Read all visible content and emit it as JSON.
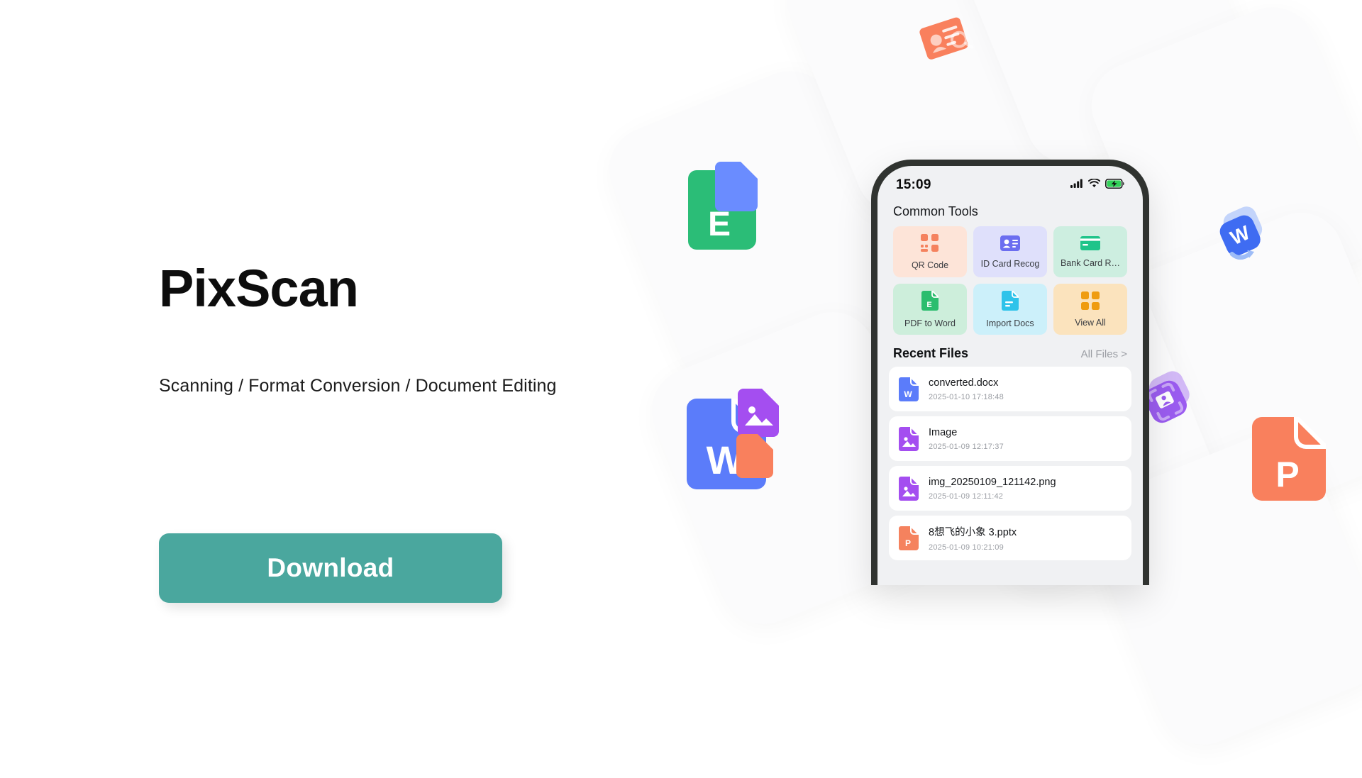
{
  "hero": {
    "title": "PixScan",
    "subtitle": "Scanning / Format Conversion / Document Editing",
    "download_label": "Download",
    "accent_color": "#4aa79e"
  },
  "phone": {
    "status_bar": {
      "time": "15:09",
      "icons": [
        "cellular-signal-icon",
        "wifi-icon",
        "battery-charging-icon"
      ],
      "battery_color": "#32d158"
    },
    "common_tools": {
      "section_title": "Common Tools",
      "items": [
        {
          "label": "QR Code",
          "icon": "qr-code-icon",
          "tile_color": "#fde4d8",
          "icon_color": "#f5825e"
        },
        {
          "label": "ID Card Recog",
          "icon": "id-card-icon",
          "tile_color": "#dfe0fb",
          "icon_color": "#6c6ef0"
        },
        {
          "label": "Bank Card R…",
          "icon": "bank-card-icon",
          "tile_color": "#cdeee0",
          "icon_color": "#1fc48a"
        },
        {
          "label": "PDF to Word",
          "icon": "pdf-to-word-icon",
          "tile_color": "#cdeedb",
          "icon_color": "#2bbd6e"
        },
        {
          "label": "Import Docs",
          "icon": "import-docs-icon",
          "tile_color": "#ccf0fa",
          "icon_color": "#2ec3ea"
        },
        {
          "label": "View All",
          "icon": "view-all-grid-icon",
          "tile_color": "#fbe3bd",
          "icon_color": "#ef9c10"
        }
      ]
    },
    "recent_files": {
      "section_title": "Recent Files",
      "all_files_label": "All Files >",
      "items": [
        {
          "name": "converted.docx",
          "date": "2025-01-10 17:18:48",
          "icon": "word-file-icon",
          "icon_color": "#5b7cfa"
        },
        {
          "name": "Image",
          "date": "2025-01-09 12:17:37",
          "icon": "image-file-icon",
          "icon_color": "#a44ef0"
        },
        {
          "name": "img_20250109_121142.png",
          "date": "2025-01-09 12:11:42",
          "icon": "image-file-icon",
          "icon_color": "#a44ef0"
        },
        {
          "name": "8想飞的小象 3.pptx",
          "date": "2025-01-09 10:21:09",
          "icon": "ppt-file-icon",
          "icon_color": "#f5825e"
        }
      ]
    }
  },
  "decorations": {
    "floating_docs": [
      {
        "name": "excel-doc-icon",
        "letter": "E",
        "color": "#2bbd77"
      },
      {
        "name": "word-doc-icon",
        "letter": "W",
        "color": "#5b7cfa"
      },
      {
        "name": "powerpoint-doc-icon",
        "letter": "P",
        "color": "#f9805d"
      },
      {
        "name": "image-doc-icon",
        "letter": "",
        "color": "#a44ef0"
      }
    ],
    "floating_badges": [
      {
        "name": "id-card-scan-badge",
        "color": "#f9805d"
      },
      {
        "name": "word-convert-badge",
        "color": "#3f6cf2"
      },
      {
        "name": "id-scan-frame-badge",
        "color": "#9b5cf0"
      }
    ]
  }
}
